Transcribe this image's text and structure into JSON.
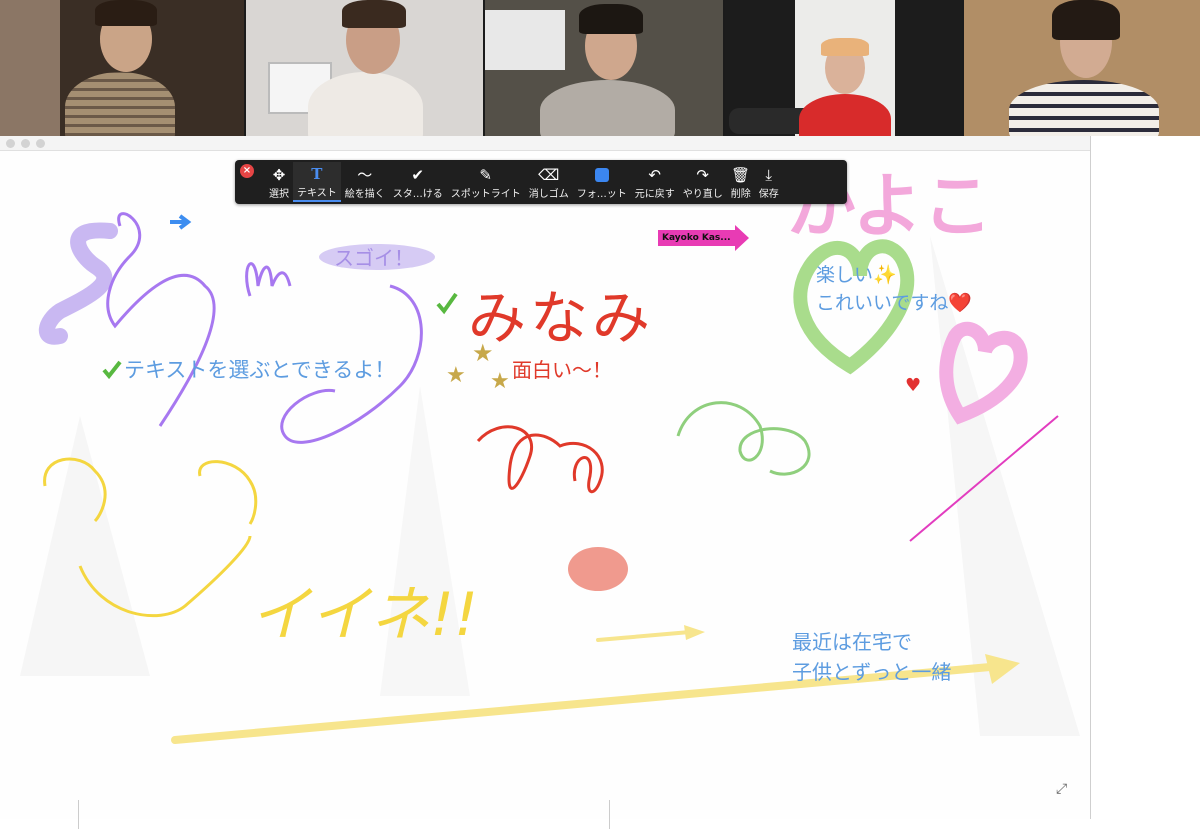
{
  "participants": [
    {
      "id": "p1",
      "colors": {
        "bg": "#3a2e25",
        "shirt": "#a58f72",
        "head": "#caa487"
      }
    },
    {
      "id": "p2",
      "colors": {
        "bg": "#d9d6d3",
        "shirt": "#eeeae5",
        "head": "#c99e86"
      }
    },
    {
      "id": "p3",
      "colors": {
        "bg": "#545048",
        "shirt": "#b2aca5",
        "head": "#cfa78d"
      }
    },
    {
      "id": "p4",
      "colors": {
        "bg": "#ececea",
        "shirt": "#d82b2b",
        "head": "#dab29a"
      },
      "active": true
    },
    {
      "id": "p5",
      "colors": {
        "bg": "#b18e66",
        "shirt": "#f2eee8",
        "head": "#d2ab92"
      }
    }
  ],
  "toolbar": {
    "close_icon": "close-x-icon",
    "items": [
      {
        "icon": "✥",
        "label": "選択",
        "name": "select"
      },
      {
        "icon": "T",
        "label": "テキスト",
        "name": "text",
        "selected": true
      },
      {
        "icon": "〜",
        "label": "絵を描く",
        "name": "draw"
      },
      {
        "icon": "✔",
        "label": "スタ…ける",
        "name": "stamp"
      },
      {
        "icon": "✎",
        "label": "スポットライト",
        "name": "spotlight"
      },
      {
        "icon": "⌫",
        "label": "消しゴム",
        "name": "eraser"
      },
      {
        "icon": "",
        "label": "フォ…ット",
        "name": "format"
      },
      {
        "icon": "↶",
        "label": "元に戻す",
        "name": "undo"
      },
      {
        "icon": "↷",
        "label": "やり直し",
        "name": "redo"
      },
      {
        "icon": "🗑",
        "label": "削除",
        "name": "delete"
      },
      {
        "icon": "⤓",
        "label": "保存",
        "name": "save"
      }
    ]
  },
  "annotations": {
    "sugoi": "スゴイ！",
    "text_tip": "テキストを選ぶとできるよ！",
    "minami": "みなみ",
    "omoshiroi": "面白い〜！",
    "tanoshii": "楽しい✨",
    "koreii": "これいいですね❤️",
    "kayoko": "かよこ",
    "iine": "イイネ!!",
    "saikin": "最近は在宅で",
    "kodomo": "子供とずっと一緒"
  },
  "name_tag": {
    "label": "Kayoko Kas..."
  },
  "colors": {
    "accent": "#4a8df0",
    "lavender": "#c9b8f2",
    "purple": "#a778f0",
    "red": "#e0392a",
    "pink": "#f29ad6",
    "yellow": "#f4d640",
    "light_yellow": "#f7e58d",
    "green": "#8fcf7d",
    "blue_text": "#5d9ce0",
    "gold": "#c7a84a",
    "magenta": "#e23cbf"
  }
}
